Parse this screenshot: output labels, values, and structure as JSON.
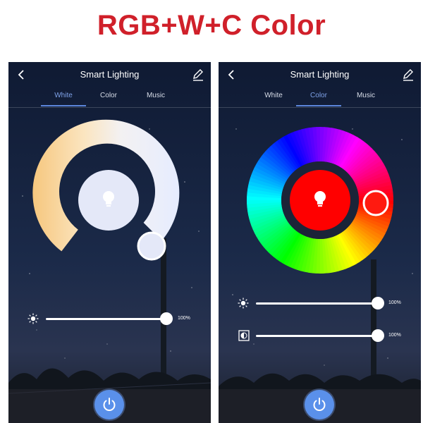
{
  "headline": "RGB+W+C Color",
  "colors": {
    "headline": "#d0202a",
    "accent": "#5c86db",
    "power_button": "#5a90ea",
    "rgb_selected": "#ff0000",
    "white_selected": "#e4e8f8"
  },
  "phones": [
    {
      "nav": {
        "title": "Smart Lighting",
        "back_icon": "chevron-left-icon",
        "edit_icon": "pencil-icon"
      },
      "tabs": [
        {
          "label": "White",
          "active": true
        },
        {
          "label": "Color",
          "active": false
        },
        {
          "label": "Music",
          "active": false
        }
      ],
      "wheel": {
        "type": "white-temperature-arc",
        "selected_color": "#e4e8f8",
        "center_icon": "bulb-icon"
      },
      "sliders": [
        {
          "name": "brightness",
          "icon": "sun-icon",
          "value_percent": 100,
          "label": "100%"
        }
      ],
      "power_icon": "power-icon"
    },
    {
      "nav": {
        "title": "Smart Lighting",
        "back_icon": "chevron-left-icon",
        "edit_icon": "pencil-icon"
      },
      "tabs": [
        {
          "label": "White",
          "active": false
        },
        {
          "label": "Color",
          "active": true
        },
        {
          "label": "Music",
          "active": false
        }
      ],
      "wheel": {
        "type": "rgb-hue-ring",
        "selected_color": "#ff0000",
        "center_icon": "bulb-icon"
      },
      "sliders": [
        {
          "name": "brightness",
          "icon": "sun-icon",
          "value_percent": 100,
          "label": "100%"
        },
        {
          "name": "saturation",
          "icon": "contrast-icon",
          "value_percent": 100,
          "label": "100%"
        }
      ],
      "power_icon": "power-icon"
    }
  ]
}
